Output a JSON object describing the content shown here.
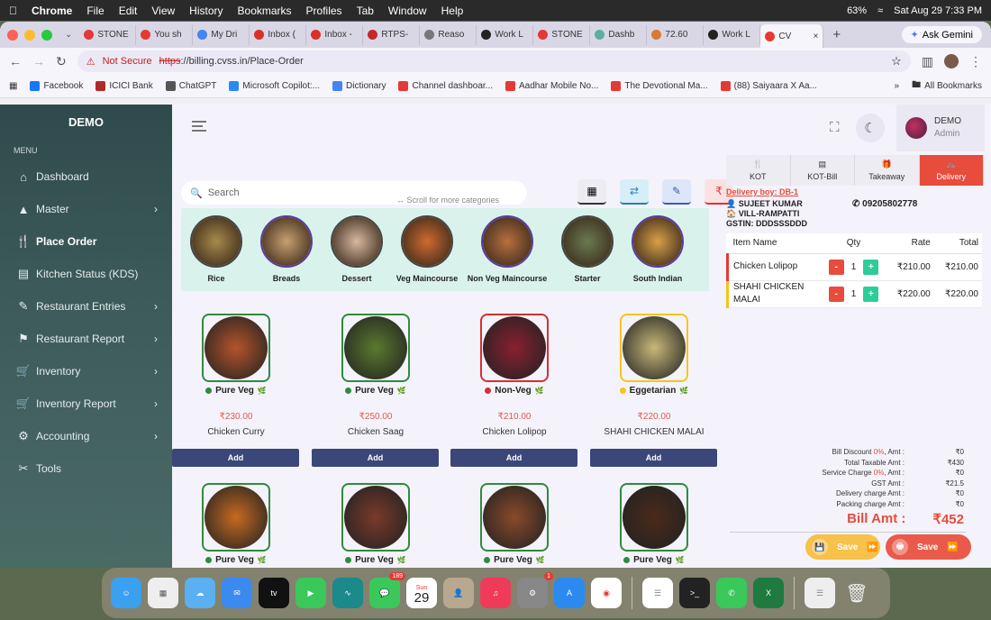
{
  "mac": {
    "app_name": "Chrome",
    "menus": [
      "File",
      "Edit",
      "View",
      "History",
      "Bookmarks",
      "Profiles",
      "Tab",
      "Window",
      "Help"
    ],
    "battery": "63%",
    "clock": "Sat Aug 29  7:33 PM"
  },
  "browser": {
    "tabs": [
      "STONE",
      "You sh",
      "My Dri",
      "Inbox (",
      "Inbox -",
      "RTPS-",
      "Reaso",
      "Work L",
      "STONE",
      "Dashb",
      "72.60",
      "Work L",
      "CV"
    ],
    "ask_gemini": "Ask Gemini",
    "not_secure": "Not Secure",
    "url_scheme": "https",
    "url_rest": "://billing.cvss.in/Place-Order",
    "bookmarks": [
      "Facebook",
      "ICICI Bank",
      "ChatGPT",
      "Microsoft Copilot:...",
      "Dictionary",
      "Channel dashboar...",
      "Aadhar Mobile No...",
      "The Devotional Ma...",
      "(88) Saiyaara X Aa..."
    ],
    "all_bookmarks": "All Bookmarks"
  },
  "sidebar": {
    "brand": "DEMO",
    "menu_heading": "MENU",
    "items": [
      {
        "label": "Dashboard",
        "icon": "home-icon"
      },
      {
        "label": "Master",
        "icon": "triangle-icon"
      },
      {
        "label": "Place Order",
        "icon": "fork-knife-icon"
      },
      {
        "label": "Kitchen Status (KDS)",
        "icon": "kitchen-icon"
      },
      {
        "label": "Restaurant Entries",
        "icon": "entries-icon"
      },
      {
        "label": "Restaurant Report",
        "icon": "flag-icon"
      },
      {
        "label": "Inventory",
        "icon": "cart-icon"
      },
      {
        "label": "Inventory Report",
        "icon": "cart-icon"
      },
      {
        "label": "Accounting",
        "icon": "gear-icon"
      },
      {
        "label": "Tools",
        "icon": "tools-icon"
      }
    ]
  },
  "user": {
    "name": "DEMO",
    "role": "Admin"
  },
  "search": {
    "placeholder": "Search",
    "scroll_hint": "Scroll for more categories"
  },
  "toolbar": {
    "rupee": "₹"
  },
  "categories": [
    {
      "label": "Rice",
      "color": "#a88a4a"
    },
    {
      "label": "Breads",
      "color": "#c8a070"
    },
    {
      "label": "Dessert",
      "color": "#d8b8a0"
    },
    {
      "label": "Veg Maincourse",
      "color": "#d06a30"
    },
    {
      "label": "Non Veg Maincourse",
      "color": "#b87040"
    },
    {
      "label": "Starter",
      "color": "#6a7a50"
    },
    {
      "label": "South Indian",
      "color": "#d9a04a"
    }
  ],
  "products": [
    {
      "tag": "Pure Veg",
      "dot": "#2e8b3e",
      "price": "₹230.00",
      "name": "Chicken Curry",
      "add": "Add",
      "color": "#b5542a",
      "border": "#2e8b3e"
    },
    {
      "tag": "Pure Veg",
      "dot": "#2e8b3e",
      "price": "₹250.00",
      "name": "Chicken Saag",
      "add": "Add",
      "color": "#5a7a2e",
      "border": "#2e8b3e"
    },
    {
      "tag": "Non-Veg",
      "dot": "#d32f2f",
      "price": "₹210.00",
      "name": "Chicken Lolipop",
      "add": "Add",
      "color": "#8a2030",
      "border": "#d32f2f"
    },
    {
      "tag": "Eggetarian",
      "dot": "#f5c518",
      "price": "₹220.00",
      "name": "SHAHI CHICKEN MALAI",
      "add": "Add",
      "color": "#c8b878",
      "border": "#f5c518"
    },
    {
      "tag": "Pure Veg",
      "dot": "#2e8b3e",
      "price": "",
      "name": "",
      "add": "",
      "color": "#c86a20",
      "border": "#2e8b3e"
    },
    {
      "tag": "Pure Veg",
      "dot": "#2e8b3e",
      "price": "",
      "name": "",
      "add": "",
      "color": "#7a3a2a",
      "border": "#2e8b3e"
    },
    {
      "tag": "Pure Veg",
      "dot": "#2e8b3e",
      "price": "",
      "name": "",
      "add": "",
      "color": "#8a4a2a",
      "border": "#2e8b3e"
    },
    {
      "tag": "Pure Veg",
      "dot": "#2e8b3e",
      "price": "",
      "name": "",
      "add": "",
      "color": "#4a2a1a",
      "border": "#2e8b3e"
    }
  ],
  "order_tabs": [
    {
      "label": "KOT",
      "icon": "utensils-icon"
    },
    {
      "label": "KOT-Bill",
      "icon": "receipt-icon"
    },
    {
      "label": "Takeaway",
      "icon": "gift-icon"
    },
    {
      "label": "Delivery",
      "icon": "bicycle-icon"
    }
  ],
  "delivery": {
    "boy": "Delivery boy: DB-1",
    "customer": "SUJEET KUMAR",
    "address": "VILL-RAMPATTI",
    "gstin": "GSTIN: DDDSSSDDD",
    "phone": "09205802778"
  },
  "order_table": {
    "headers": [
      "Item Name",
      "Qty",
      "Rate",
      "Total"
    ],
    "rows": [
      {
        "name": "Chicken Lolipop",
        "qty": "1",
        "rate": "₹210.00",
        "total": "₹210.00",
        "bar": "#e53935"
      },
      {
        "name": "SHAHI CHICKEN MALAI",
        "qty": "1",
        "rate": "₹220.00",
        "total": "₹220.00",
        "bar": "#f5c518"
      }
    ],
    "minus": "-",
    "plus": "+"
  },
  "summary": {
    "bill_discount_label": "Bill Discount ",
    "bill_discount_pct": "0%",
    "bill_discount_suffix": ", Amt :",
    "bill_discount": "₹0",
    "taxable_label": "Total Taxable Amt :",
    "taxable": "₹430",
    "service_label": "Service Charge ",
    "service_pct": "0%",
    "service_suffix": ", Amt :",
    "service": "₹0",
    "gst_label": "GST Amt :",
    "gst": "₹21.5",
    "delivery_label": "Delivery charge Amt :",
    "delivery": "₹0",
    "packing_label": "Packing charge Amt :",
    "packing": "₹0",
    "bill_label": "Bill Amt :",
    "bill": "₹452"
  },
  "actions": {
    "save": "Save",
    "save_print": "Save"
  },
  "dock": {
    "messages_badge": "189",
    "settings_badge": "1",
    "calendar_month": "Sun",
    "calendar_day": "29"
  }
}
